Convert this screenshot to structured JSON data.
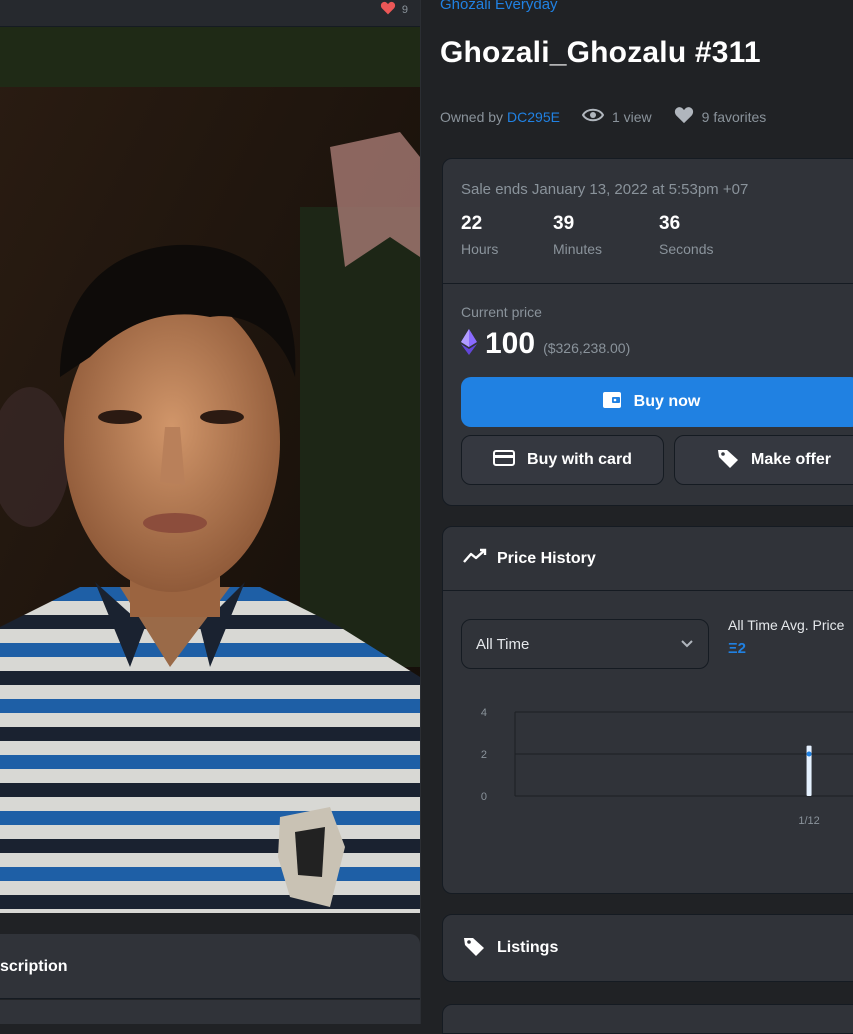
{
  "left": {
    "favorites_mini_count": "9",
    "description_title": "scription"
  },
  "collection_name": "Ghozali Everyday",
  "item_title": "Ghozali_Ghozalu #311",
  "meta": {
    "owned_by_label": "Owned by",
    "owner": "DC295E",
    "views": "1 view",
    "favorites": "9 favorites"
  },
  "sale": {
    "ends_text": "Sale ends January 13, 2022 at 5:53pm +07",
    "countdown": {
      "hours": "22",
      "hours_label": "Hours",
      "minutes": "39",
      "minutes_label": "Minutes",
      "seconds": "36",
      "seconds_label": "Seconds"
    },
    "current_price_label": "Current price",
    "price": "100",
    "price_usd": "($326,238.00)",
    "buy_now_label": "Buy now",
    "buy_card_label": "Buy with card",
    "make_offer_label": "Make offer"
  },
  "price_history": {
    "title": "Price History",
    "range_selected": "All Time",
    "avg_label": "All Time Avg. Price",
    "avg_value": "Ξ2"
  },
  "chart_data": {
    "type": "bar",
    "categories": [
      "1/12"
    ],
    "values": [
      2
    ],
    "title": "",
    "xlabel": "",
    "ylabel": "",
    "ylim": [
      0,
      4
    ],
    "yticks": [
      "4",
      "2",
      "0"
    ],
    "grid": true
  },
  "listings": {
    "title": "Listings"
  },
  "colors": {
    "accent": "#2081e2",
    "background": "#202225",
    "card": "#303339",
    "favorite": "#eb5757",
    "eth": "#8a6bff"
  }
}
